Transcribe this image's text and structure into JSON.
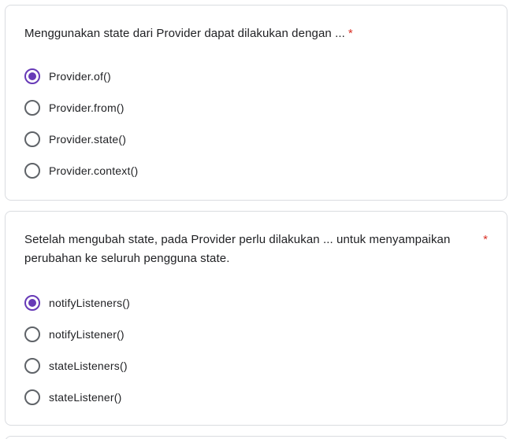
{
  "colors": {
    "accent": "#673ab7",
    "required": "#d93025",
    "text": "#202124",
    "radio_border": "#5f6368",
    "card_border": "#dadce0"
  },
  "questions": [
    {
      "text": "Menggunakan state dari Provider dapat dilakukan dengan ...",
      "required_mark": "*",
      "selected_index": 0,
      "options": [
        {
          "label": "Provider.of()"
        },
        {
          "label": "Provider.from()"
        },
        {
          "label": "Provider.state()"
        },
        {
          "label": "Provider.context()"
        }
      ]
    },
    {
      "text": "Setelah mengubah state, pada Provider perlu dilakukan ... untuk menyampaikan perubahan ke seluruh pengguna state.",
      "required_mark": "*",
      "selected_index": 0,
      "options": [
        {
          "label": "notifyListeners()"
        },
        {
          "label": "notifyListener()"
        },
        {
          "label": "stateListeners()"
        },
        {
          "label": "stateListener()"
        }
      ]
    }
  ]
}
